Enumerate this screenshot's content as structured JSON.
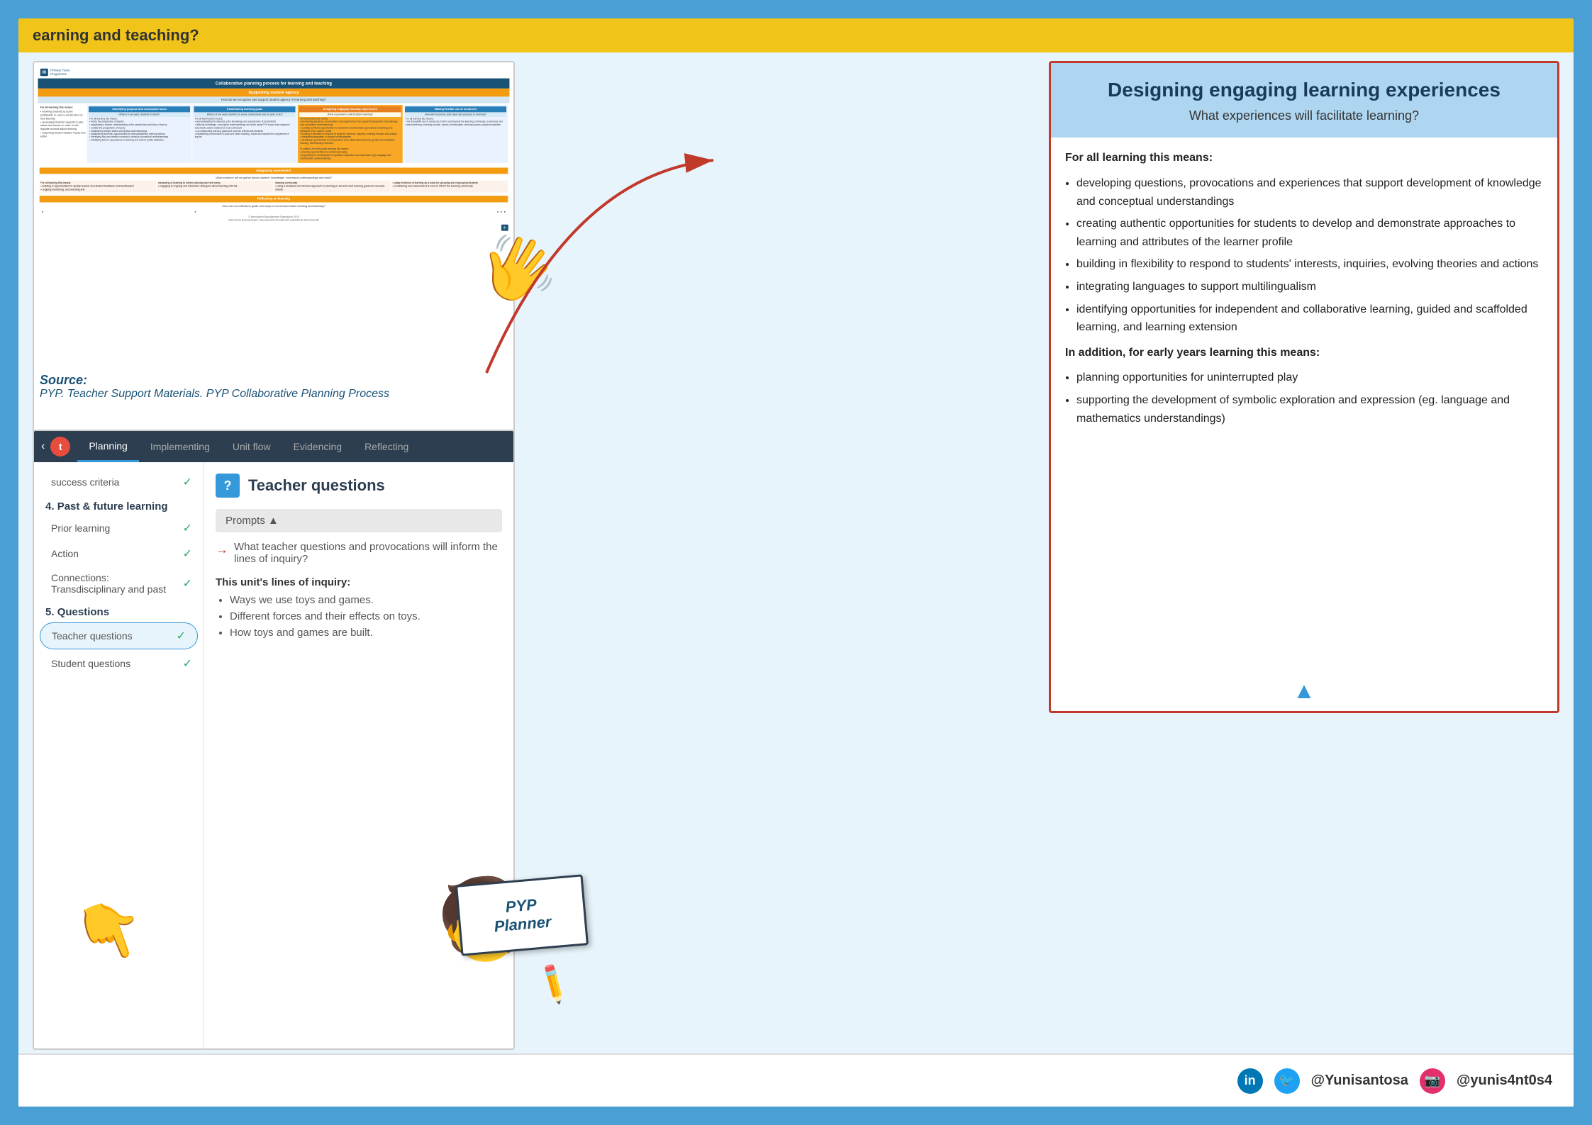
{
  "header": {
    "strip_text": "earning and teaching?"
  },
  "source": {
    "label": "Source:",
    "citation": "PYP. Teacher Support Materials. PYP Collaborative Planning Process"
  },
  "ib_document": {
    "title": "Collaborative planning process for learning and teaching",
    "section_title": "Supporting student agency",
    "section_subtitle": "How do we recognise and support student agency in learning and teaching?",
    "columns": [
      {
        "header": "Identifying purpose and conceptual focus",
        "subtitle": "What is it we want students to know?",
        "color": "blue"
      },
      {
        "header": "Establishing learning goals",
        "subtitle": "What is it we want students to know, understand and be able to do?",
        "color": "blue"
      },
      {
        "header": "Designing engaging learning experiences",
        "subtitle": "What experiences will facilitate learning?",
        "color": "yellow"
      },
      {
        "header": "Making flexible use of resources",
        "subtitle": "How will resources add value and purpose to learning?",
        "color": "blue"
      }
    ]
  },
  "right_panel": {
    "title": "Designing engaging learning experiences",
    "subtitle": "What experiences will facilitate learning?",
    "intro": "For all learning this means:",
    "points": [
      "developing questions, provocations and experiences that support development of knowledge and conceptual understandings",
      "creating authentic opportunities for students to develop and demonstrate approaches to learning and attributes of the learner profile",
      "building in flexibility to respond to students' interests, inquiries, evolving theories and actions",
      "integrating languages to support multilingualism",
      "identifying opportunities for independent and collaborative learning, guided and scaffolded learning, and learning extension"
    ],
    "early_years_intro": "In addition, for early years learning this means:",
    "early_years_points": [
      "planning opportunities for uninterrupted play",
      "supporting the development of symbolic exploration and expression (eg. language and mathematics understandings)"
    ]
  },
  "nav_tabs": {
    "back_icon": "‹",
    "circle_letter": "t",
    "tabs": [
      {
        "label": "Planning",
        "active": true
      },
      {
        "label": "Implementing",
        "active": false
      },
      {
        "label": "Unit flow",
        "active": false
      },
      {
        "label": "Evidencing",
        "active": false
      },
      {
        "label": "Reflecting",
        "active": false
      }
    ]
  },
  "sidebar": {
    "section4": {
      "number": "4.",
      "label": "Past & future learning"
    },
    "items4": [
      {
        "label": "Prior learning",
        "checked": true
      },
      {
        "label": "Action",
        "checked": true
      },
      {
        "label": "Connections: Transdisciplinary and past",
        "checked": true
      }
    ],
    "section5": {
      "number": "5.",
      "label": "Questions"
    },
    "items5": [
      {
        "label": "Teacher questions",
        "active": true,
        "checked": true
      },
      {
        "label": "Student questions",
        "checked": true
      }
    ]
  },
  "teacher_questions": {
    "title": "Teacher questions",
    "icon": "?",
    "prompts_label": "Prompts ▲",
    "prompt_question": "What teacher questions and provocations will inform the lines of inquiry?",
    "lines_of_inquiry_title": "This unit's lines of inquiry:",
    "lines": [
      "Ways we use toys and games.",
      "Different forces and their effects on toys.",
      "How toys and games are built."
    ]
  },
  "pyp_planner": {
    "line1": "PYP",
    "line2": "Planner"
  },
  "footer": {
    "handles": [
      {
        "icon": "in",
        "color": "linkedin",
        "text": "@Yunisantosa"
      },
      {
        "icon": "🐦",
        "color": "twitter",
        "text": "@Yunisantosa"
      },
      {
        "icon": "📷",
        "color": "instagram",
        "text": "@yunis4nt0s4"
      }
    ]
  }
}
